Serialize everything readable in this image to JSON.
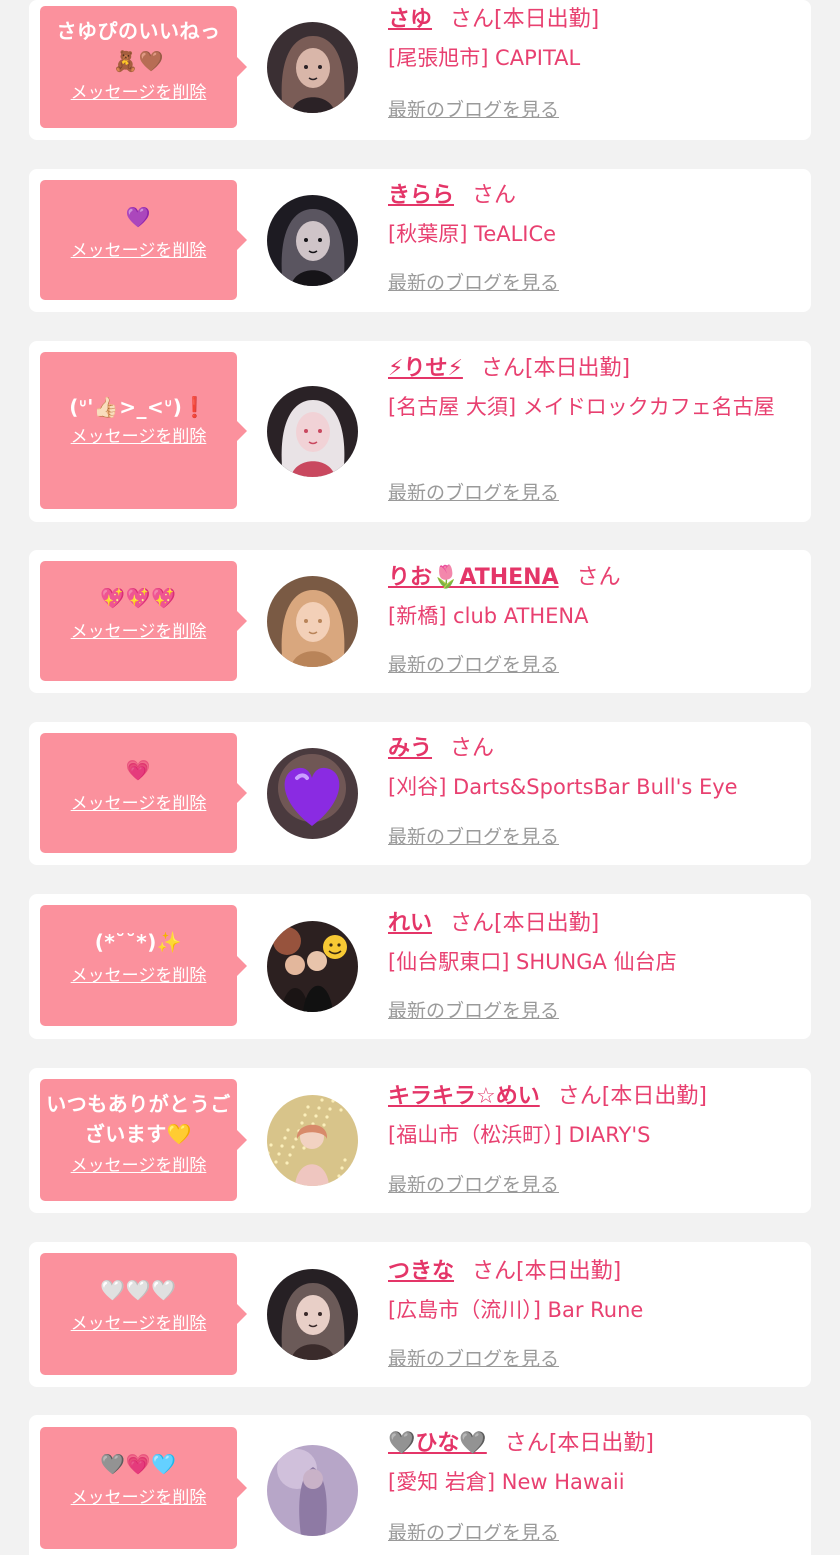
{
  "delete_label": "メッセージを削除",
  "blog_label": "最新のブログを見る",
  "san_label": "さん",
  "colors": {
    "bubble": "#fb919d",
    "accent": "#e43568",
    "muted": "#9a9a9a",
    "background": "#f2f2f2"
  },
  "items": [
    {
      "message": "さゆぴのいいねっ🧸🤎",
      "name": "さゆ",
      "tag": "[本日出勤]",
      "shop": "[尾張旭市] CAPITAL",
      "avatar": "girl-photo"
    },
    {
      "message": "💜",
      "name": "きらら",
      "tag": "",
      "shop": "[秋葉原] TeALICe",
      "avatar": "girl-photo"
    },
    {
      "message": "(ᐡ'👍🏻>_<ᐡ)❗",
      "name": "⚡りせ⚡",
      "tag": "[本日出勤]",
      "shop": "[名古屋 大須] メイドロックカフェ名古屋",
      "avatar": "girl-photo"
    },
    {
      "message": "💖💖💖",
      "name": "りお🌷ATHENA",
      "tag": "",
      "shop": "[新橋] club ATHENA",
      "avatar": "girl-photo"
    },
    {
      "message": "💗",
      "name": "みう",
      "tag": "",
      "shop": "[刈谷] Darts&SportsBar Bull's Eye",
      "avatar": "purple-heart"
    },
    {
      "message": "(*˘˘*)✨",
      "name": "れい",
      "tag": "[本日出勤]",
      "shop": "[仙台駅東口] SHUNGA 仙台店",
      "avatar": "group-photo"
    },
    {
      "message": "いつもありがとうございます💛",
      "name": "キラキラ☆めい",
      "tag": "[本日出勤]",
      "shop": "[福山市（松浜町）] DIARY'S",
      "avatar": "glitter-photo"
    },
    {
      "message": "🤍🤍🤍",
      "name": "つきな",
      "tag": "[本日出勤]",
      "shop": "[広島市（流川）] Bar Rune",
      "avatar": "girl-photo"
    },
    {
      "message": "🩶💗🩵",
      "name": "🩶ひな🩶",
      "tag": "[本日出勤]",
      "shop": "[愛知 岩倉] New Hawaii",
      "avatar": "lavender-photo"
    }
  ]
}
